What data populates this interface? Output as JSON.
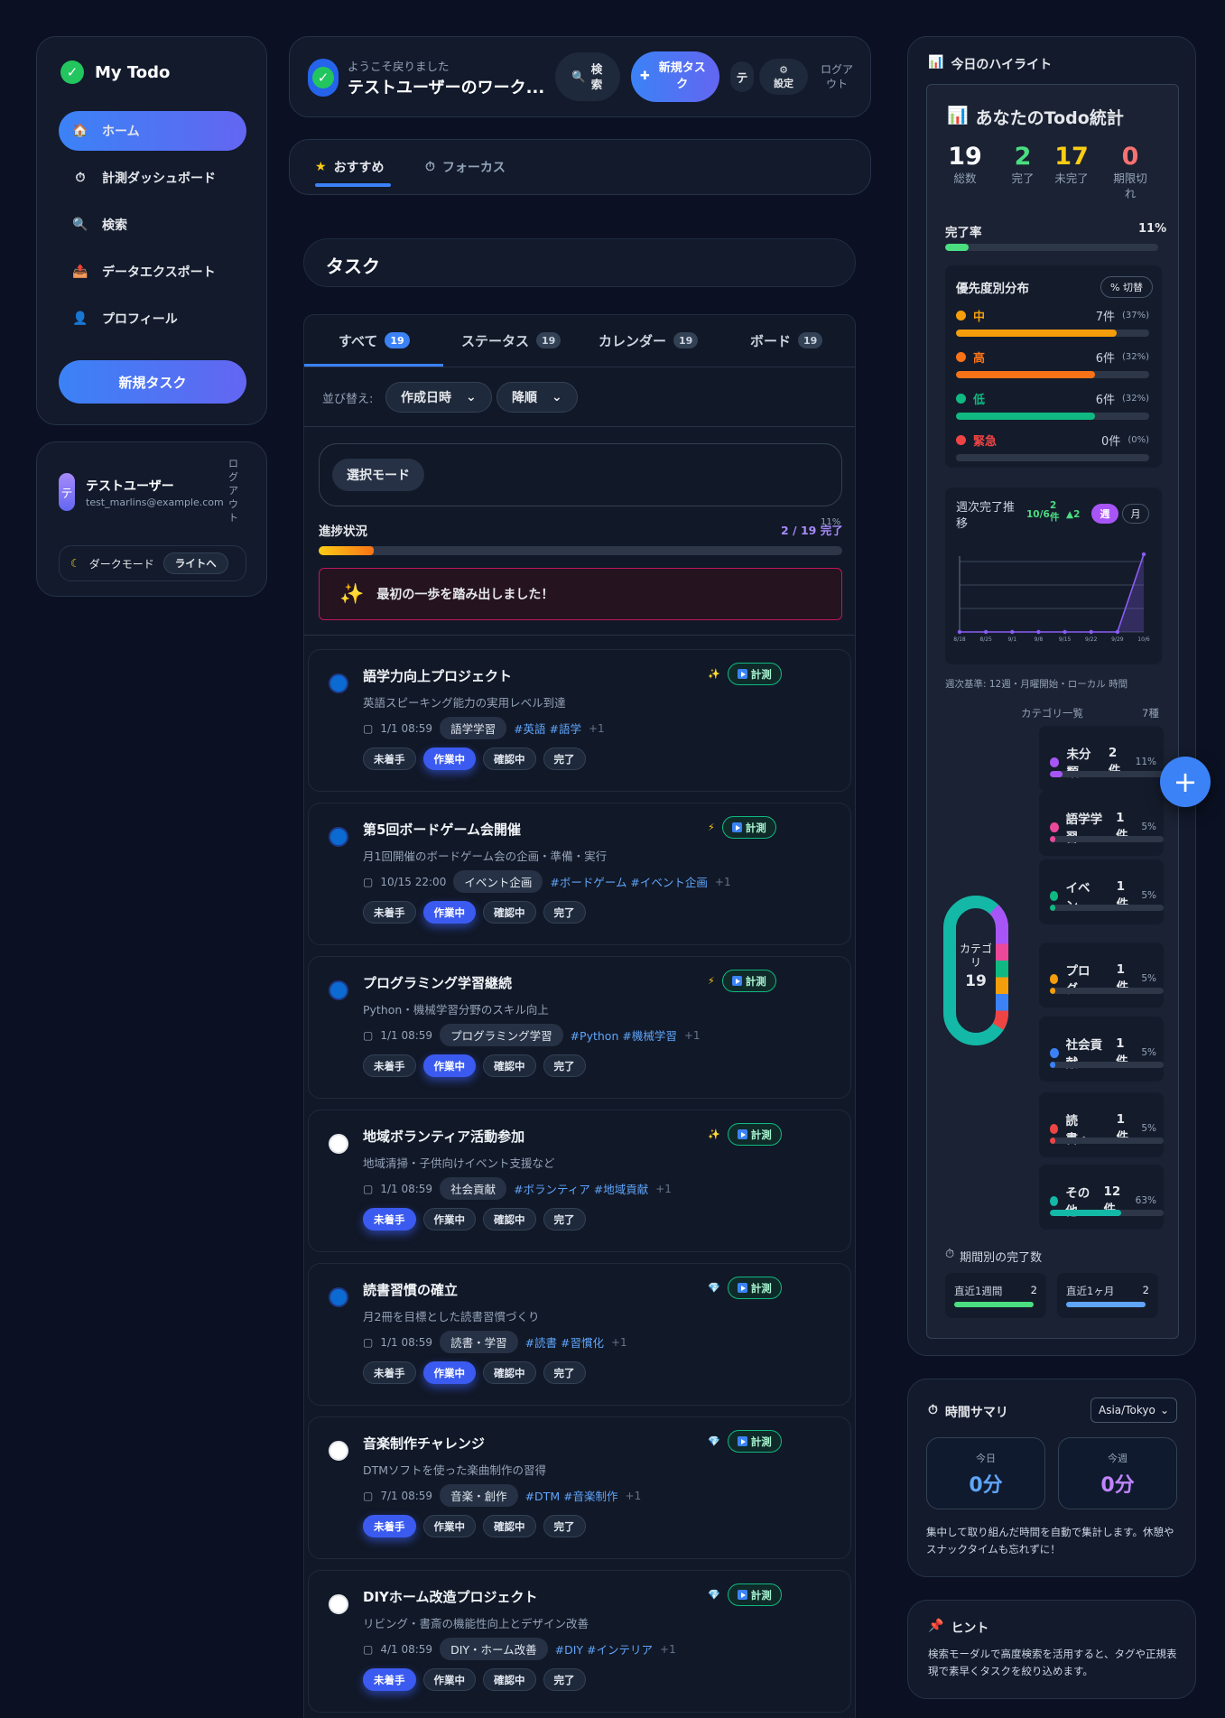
{
  "sidebar": {
    "brand": "My Todo",
    "items": [
      {
        "label": "ホーム",
        "icon": "🏠"
      },
      {
        "label": "計測ダッシュボード",
        "icon": "⏱"
      },
      {
        "label": "検索",
        "icon": "🔍"
      },
      {
        "label": "データエクスポート",
        "icon": "📤"
      },
      {
        "label": "プロフィール",
        "icon": "👤"
      }
    ],
    "new_task": "新規タスク"
  },
  "user": {
    "avatar": "テ",
    "name": "テストユーザー",
    "email": "test_marlins@example.com",
    "logout": "ログアウト",
    "dark_mode": "ダークモード",
    "light_btn": "ライトへ"
  },
  "header": {
    "welcome": "ようこそ戻りました",
    "workspace": "テストユーザーのワーク...",
    "search": "検索",
    "new_task": "新規タスク",
    "avatar": "テ",
    "settings": "設定",
    "logout": "ログアウト"
  },
  "view_tabs": [
    {
      "label": "おすすめ",
      "icon": "★"
    },
    {
      "label": "フォーカス",
      "icon": "⏱"
    }
  ],
  "task_title": "タスク",
  "task_tabs": [
    {
      "label": "すべて",
      "count": "19"
    },
    {
      "label": "ステータス",
      "count": "19"
    },
    {
      "label": "カレンダー",
      "count": "19"
    },
    {
      "label": "ボード",
      "count": "19"
    }
  ],
  "sort": {
    "label": "並び替え:",
    "field": "作成日時",
    "order": "降順"
  },
  "select_mode": "選択モード",
  "progress": {
    "label": "進捗状況",
    "value": "2 / 19 完了",
    "pct_text": "11%",
    "fraction": 0.11
  },
  "banner": {
    "icon": "✨",
    "text": "最初の一歩を踏み出しました！"
  },
  "status_labels": [
    "未着手",
    "作業中",
    "確認中",
    "完了"
  ],
  "measure": "計測",
  "tasks": [
    {
      "title": "語学力向上プロジェクト",
      "desc": "英語スピーキング能力の実用レベル到達",
      "date": "1/1 08:59",
      "cat": "語学学習",
      "tags": "#英語 #語学",
      "more": "+1",
      "icon": "✨",
      "status": 1,
      "circle": "#0b6bd3"
    },
    {
      "title": "第5回ボードゲーム会開催",
      "desc": "月1回開催のボードゲーム会の企画・準備・実行",
      "date": "10/15 22:00",
      "cat": "イベント企画",
      "tags": "#ボードゲーム #イベント企画",
      "more": "+1",
      "icon": "⚡",
      "status": 1,
      "circle": "#0b6bd3"
    },
    {
      "title": "プログラミング学習継続",
      "desc": "Python・機械学習分野のスキル向上",
      "date": "1/1 08:59",
      "cat": "プログラミング学習",
      "tags": "#Python #機械学習",
      "more": "+1",
      "icon": "⚡",
      "status": 1,
      "circle": "#0b6bd3"
    },
    {
      "title": "地域ボランティア活動参加",
      "desc": "地域清掃・子供向けイベント支援など",
      "date": "1/1 08:59",
      "cat": "社会貢献",
      "tags": "#ボランティア #地域貢献",
      "more": "+1",
      "icon": "✨",
      "status": 0,
      "circle": "#ffffff"
    },
    {
      "title": "読書習慣の確立",
      "desc": "月2冊を目標とした読書習慣づくり",
      "date": "1/1 08:59",
      "cat": "読書・学習",
      "tags": "#読書 #習慣化",
      "more": "+1",
      "icon": "💎",
      "status": 1,
      "circle": "#0b6bd3"
    },
    {
      "title": "音楽制作チャレンジ",
      "desc": "DTMソフトを使った楽曲制作の習得",
      "date": "7/1 08:59",
      "cat": "音楽・創作",
      "tags": "#DTM #音楽制作",
      "more": "+1",
      "icon": "💎",
      "status": 0,
      "circle": "#ffffff"
    },
    {
      "title": "DIYホーム改造プロジェクト",
      "desc": "リビング・書斎の機能性向上とデザイン改善",
      "date": "4/1 08:59",
      "cat": "DIY・ホーム改善",
      "tags": "#DIY #インテリア",
      "more": "+1",
      "icon": "💎",
      "status": 0,
      "circle": "#ffffff"
    }
  ],
  "highlight": {
    "title": "今日のハイライト",
    "stats_title": "あなたのTodo統計"
  },
  "stats": [
    {
      "value": "19",
      "label": "総数",
      "color": "#f8fafc"
    },
    {
      "value": "2",
      "label": "完了",
      "color": "#4ade80"
    },
    {
      "value": "17",
      "label": "未完了",
      "color": "#facc15"
    },
    {
      "value": "0",
      "label": "期限切れ",
      "color": "#f87171"
    }
  ],
  "completion": {
    "label": "完了率",
    "value": "11%",
    "fraction": 0.11
  },
  "priority": {
    "title": "優先度別分布",
    "toggle": "% 切替",
    "rows": [
      {
        "name": "中",
        "count": "7件",
        "pct": "(37%)",
        "fraction": 0.37,
        "color": "#f59e0b"
      },
      {
        "name": "高",
        "count": "6件",
        "pct": "(32%)",
        "fraction": 0.32,
        "color": "#f97316"
      },
      {
        "name": "低",
        "count": "6件",
        "pct": "(32%)",
        "fraction": 0.32,
        "color": "#10b981"
      },
      {
        "name": "緊急",
        "count": "0件",
        "pct": "(0%)",
        "fraction": 0,
        "color": "#ef4444"
      }
    ]
  },
  "weekly": {
    "title": "週次完了推移",
    "date": "10/6",
    "count": "2件",
    "delta": "▲2",
    "week": "週",
    "month": "月",
    "note": "週次基準: 12週・月曜開始・ローカル 時間",
    "x": [
      "8/18",
      "8/25",
      "9/1",
      "9/8",
      "9/15",
      "9/22",
      "9/29",
      "10/6"
    ],
    "y": [
      0,
      0,
      0,
      0,
      0,
      0,
      0,
      2
    ]
  },
  "categories": {
    "title": "カテゴリ一覧",
    "kinds": "7種",
    "donut_label": "カテゴリ",
    "donut_total": "19",
    "items": [
      {
        "name": "未分類",
        "count": "2件",
        "pct": "11%",
        "fraction": 0.11,
        "color": "#a855f7"
      },
      {
        "name": "語学学習",
        "count": "1件",
        "pct": "5%",
        "fraction": 0.05,
        "color": "#ec4899"
      },
      {
        "name": "イベン...",
        "count": "1件",
        "pct": "5%",
        "fraction": 0.05,
        "color": "#10b981"
      },
      {
        "name": "プログ...",
        "count": "1件",
        "pct": "5%",
        "fraction": 0.05,
        "color": "#f59e0b"
      },
      {
        "name": "社会貢献",
        "count": "1件",
        "pct": "5%",
        "fraction": 0.05,
        "color": "#3b82f6"
      },
      {
        "name": "読書・...",
        "count": "1件",
        "pct": "5%",
        "fraction": 0.05,
        "color": "#ef4444"
      },
      {
        "name": "その他",
        "count": "12件",
        "pct": "63%",
        "fraction": 0.63,
        "color": "#14b8a6"
      }
    ]
  },
  "period": {
    "title": "期間別の完了数",
    "items": [
      {
        "label": "直近1週間",
        "value": "2",
        "color": "#4ade80"
      },
      {
        "label": "直近1ヶ月",
        "value": "2",
        "color": "#60a5fa"
      }
    ]
  },
  "time_summary": {
    "title": "時間サマリ",
    "tz": "Asia/Tokyo",
    "today_label": "今日",
    "today": "0分",
    "week_label": "今週",
    "week": "0分",
    "note": "集中して取り組んだ時間を自動で集計します。休憩やスナックタイムも忘れずに！"
  },
  "hint": {
    "title": "ヒント",
    "text": "検索モーダルで高度検索を活用すると、タグや正規表現で素早くタスクを絞り込めます。"
  },
  "fab": "+"
}
